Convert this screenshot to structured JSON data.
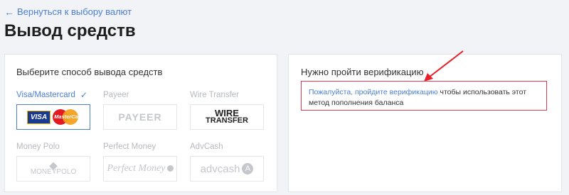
{
  "nav": {
    "back_label": "Вернуться к выбору валют"
  },
  "page": {
    "title": "Вывод средств"
  },
  "withdraw": {
    "heading": "Выберите способ вывода средств",
    "methods": [
      {
        "label": "Visa/Mastercard",
        "selected": true,
        "logo": [
          "VISA",
          "MasterCard"
        ]
      },
      {
        "label": "Payeer",
        "selected": false,
        "logo": [
          "PAYEER"
        ]
      },
      {
        "label": "Wire Transfer",
        "selected": false,
        "logo": [
          "WIRE",
          "TRANSFER"
        ]
      },
      {
        "label": "Money Polo",
        "selected": false,
        "logo": [
          "MONEYPOLO"
        ]
      },
      {
        "label": "Perfect Money",
        "selected": false,
        "logo": [
          "Perfect Money"
        ]
      },
      {
        "label": "AdvCash",
        "selected": false,
        "logo": [
          "advcash"
        ]
      }
    ]
  },
  "verification": {
    "heading": "Нужно пройти верификацию",
    "link_text": "Пожалуйста, пройдите верификацию",
    "message": " чтобы использовать этот метод пополнения баланса"
  },
  "colors": {
    "accent": "#4a7fd4",
    "alert": "#e03a52"
  },
  "icons": {
    "selected": "checkmark-icon",
    "back": "arrow-left-icon"
  }
}
